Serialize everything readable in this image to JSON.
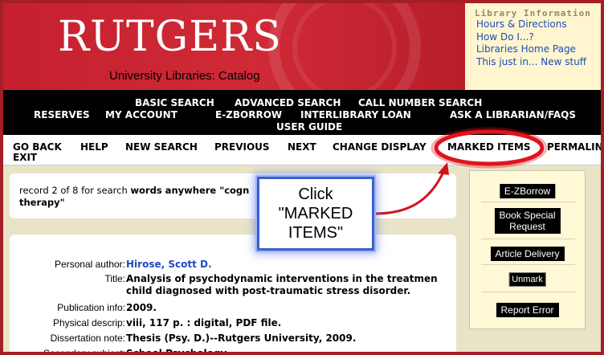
{
  "header": {
    "logo": "RUTGERS",
    "subtitle": "University Libraries: Catalog"
  },
  "library_info": {
    "heading": "Library Information",
    "links": [
      "Hours & Directions",
      "How Do I...?",
      "Libraries Home Page",
      "This just in... New stuff"
    ]
  },
  "nav": {
    "basic_search": "BASIC SEARCH",
    "advanced_search": "ADVANCED SEARCH",
    "call_number_search": "CALL NUMBER SEARCH",
    "reserves": "RESERVES",
    "my_account": "MY ACCOUNT",
    "e_zborrow": "E-ZBORROW",
    "interlibrary_loan": "INTERLIBRARY LOAN",
    "ask_librarian": "ASK A LIBRARIAN/FAQS",
    "user_guide": "USER GUIDE"
  },
  "actions": {
    "go_back": "GO BACK",
    "help": "HELP",
    "new_search": "NEW SEARCH",
    "previous": "PREVIOUS",
    "next": "NEXT",
    "change_display": "CHANGE DISPLAY",
    "marked_items": "MARKED ITEMS",
    "permalink": "PERMALINK",
    "exit": "EXIT"
  },
  "record": {
    "prefix": "record 2 of 8 for search ",
    "query_bold": "words anywhere \"cogn",
    "query_line2": "therapy\""
  },
  "details": [
    {
      "label": "Personal author:",
      "value": "Hirose, Scott D.",
      "link": true
    },
    {
      "label": "Title:",
      "value": "Analysis of psychodynamic interventions in the treatmen",
      "value2": "child diagnosed with post-traumatic stress disorder."
    },
    {
      "label": "Publication info:",
      "value": "2009."
    },
    {
      "label": "Physical descrip:",
      "value": "viii, 117 p. : digital, PDF file."
    },
    {
      "label": "Dissertation note:",
      "value": "Thesis (Psy. D.)--Rutgers University, 2009."
    },
    {
      "label": "Secondary subject:",
      "value": "School Psychology."
    }
  ],
  "side_panel": {
    "e_zborrow": "E-ZBorrow",
    "book_special_line1": "Book Special",
    "book_special_line2": "Request",
    "article_delivery": "Article Delivery",
    "unmark": "Unmark",
    "report_error": "Report Error"
  },
  "callout": {
    "line1": "Click",
    "line2": "\"MARKED",
    "line3": "ITEMS\""
  },
  "colors": {
    "brand_red": "#c6202f",
    "annotation_red": "#e0141e",
    "callout_blue": "#3b5fd0",
    "link_blue": "#1f4bbd"
  }
}
